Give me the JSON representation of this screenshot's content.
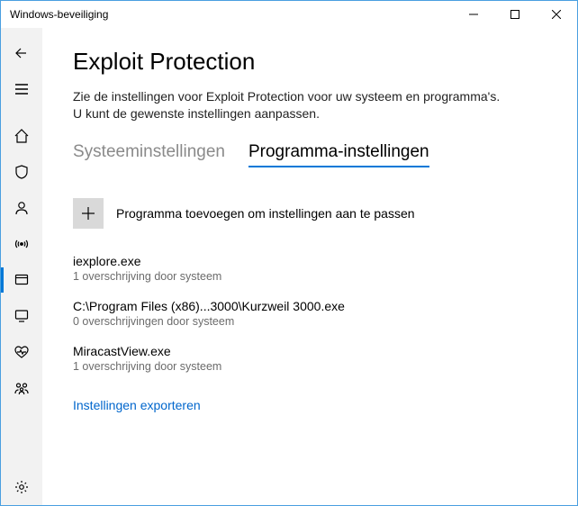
{
  "window": {
    "title": "Windows-beveiliging"
  },
  "page": {
    "heading": "Exploit Protection",
    "description": "Zie de instellingen voor Exploit Protection voor uw systeem en programma's. U kunt de gewenste instellingen aanpassen."
  },
  "tabs": {
    "system": "Systeeminstellingen",
    "program": "Programma-instellingen"
  },
  "add": {
    "label": "Programma toevoegen om instellingen aan te passen"
  },
  "programs": [
    {
      "name": "iexplore.exe",
      "sub": "1 overschrijving door systeem"
    },
    {
      "name": "C:\\Program Files (x86)...3000\\Kurzweil 3000.exe",
      "sub": "0 overschrijvingen door systeem"
    },
    {
      "name": "MiracastView.exe",
      "sub": "1 overschrijving door systeem"
    }
  ],
  "export_link": "Instellingen exporteren",
  "sidebar_icons": [
    "back",
    "menu",
    "home",
    "shield",
    "account",
    "antenna",
    "firewall",
    "device",
    "health",
    "family",
    "settings"
  ]
}
